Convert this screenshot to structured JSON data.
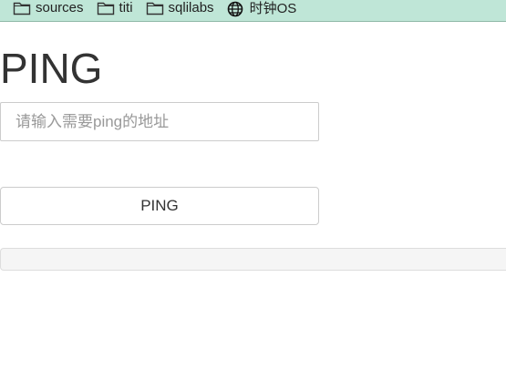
{
  "bookmarks": [
    {
      "label": "sources",
      "icon": "folder-icon"
    },
    {
      "label": "titi",
      "icon": "folder-icon"
    },
    {
      "label": "sqlilabs",
      "icon": "folder-icon"
    },
    {
      "label": "时钟OS",
      "icon": "globe-icon"
    }
  ],
  "page": {
    "title": "PING",
    "input_placeholder": "请输入需要ping的地址",
    "input_value": "",
    "button_label": "PING",
    "result_text": ""
  },
  "colors": {
    "bookmarks_bar_bg": "#bfe6d7",
    "title_text": "#333333",
    "border": "#cccccc",
    "result_bg": "#f5f5f5"
  }
}
